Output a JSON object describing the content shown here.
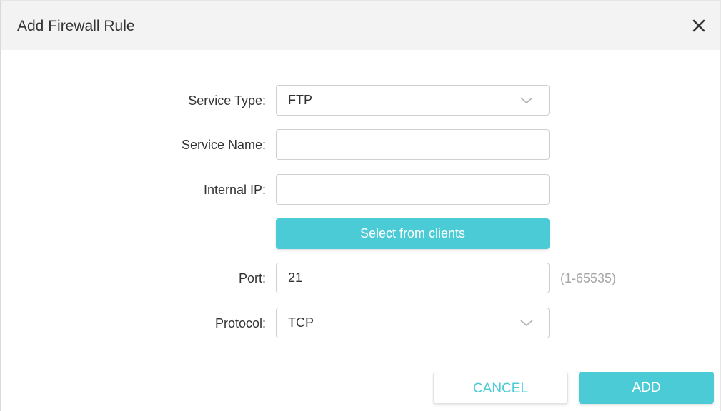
{
  "dialog": {
    "title": "Add Firewall Rule",
    "close_icon": "close-icon"
  },
  "form": {
    "service_type": {
      "label": "Service Type:",
      "value": "FTP",
      "icon": "chevron-down-icon"
    },
    "service_name": {
      "label": "Service Name:",
      "value": "",
      "placeholder": ""
    },
    "internal_ip": {
      "label": "Internal IP:",
      "value": "",
      "placeholder": ""
    },
    "select_clients_label": "Select from clients",
    "port": {
      "label": "Port:",
      "value": "21",
      "hint": "(1-65535)"
    },
    "protocol": {
      "label": "Protocol:",
      "value": "TCP",
      "icon": "chevron-down-icon"
    }
  },
  "actions": {
    "cancel_label": "CANCEL",
    "add_label": "ADD"
  },
  "colors": {
    "accent": "#4acbd6",
    "header_bg": "#f3f3f3",
    "hint_text": "#a7a7a7"
  }
}
